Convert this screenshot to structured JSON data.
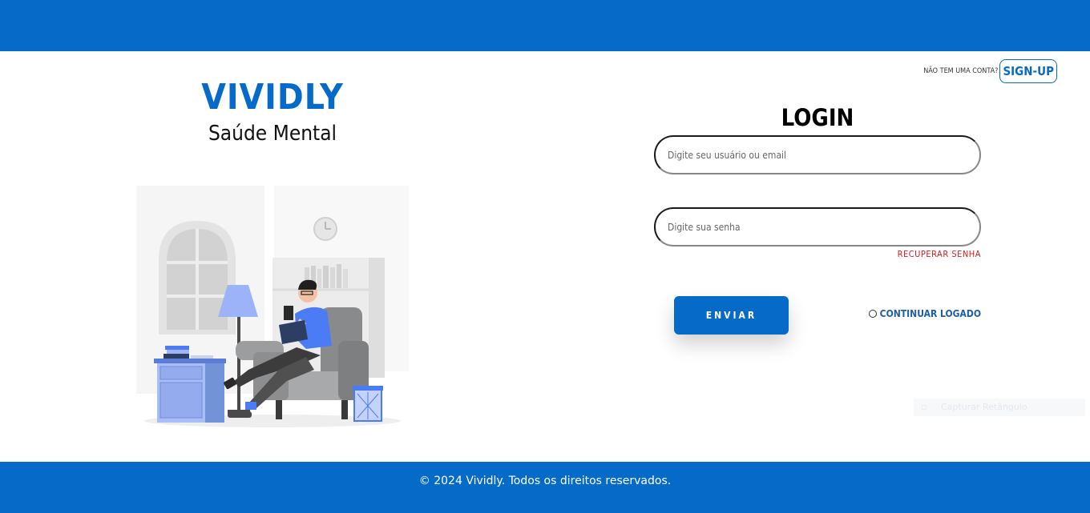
{
  "brand": {
    "name": "VIVIDLY",
    "subtitle": "Saúde Mental"
  },
  "header": {
    "signup_prompt": "NÃO TEM UMA CONTA?",
    "signup_label": "SIGN-UP"
  },
  "login": {
    "title": "LOGIN",
    "user_placeholder": "Digite seu usuário ou email",
    "password_placeholder": "Digite sua senha",
    "recover_label": "RECUPERAR SENHA",
    "submit_label": "ENVIAR",
    "keep_logged_label": "CONTINUAR LOGADO"
  },
  "footer": {
    "text": "© 2024 Vividly. Todos os direitos reservados."
  },
  "overlay": {
    "label": "Capturar Retângulo"
  },
  "colors": {
    "primary": "#066ac9",
    "error": "#d41c1c",
    "accent_blue": "#4b7bf5"
  },
  "icons": {
    "illustration": "person-reading-in-armchair-illustration",
    "overlay_icon": "rectangle-capture-icon"
  }
}
